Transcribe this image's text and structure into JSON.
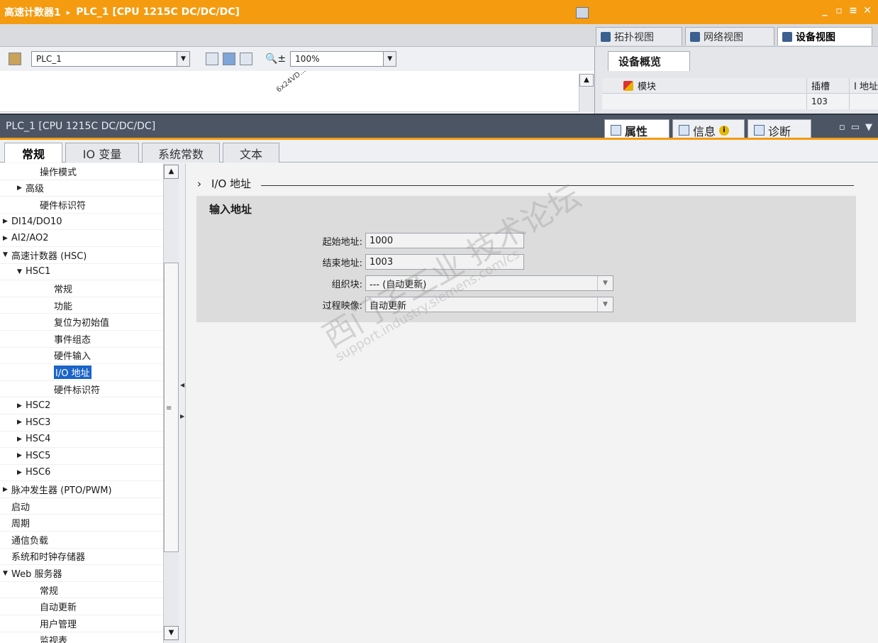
{
  "title_bar": {
    "project": "高速计数器1",
    "separator": "▸",
    "device": "PLC_1 [CPU 1215C DC/DC/DC]"
  },
  "view_tabs": [
    {
      "label": "拓扑视图",
      "active": false
    },
    {
      "label": "网络视图",
      "active": false
    },
    {
      "label": "设备视图",
      "active": true
    }
  ],
  "toolbar": {
    "device_select": "PLC_1",
    "zoom": "100%"
  },
  "device_view": {
    "module_label": "6x24VD..."
  },
  "overview": {
    "tab_label": "设备概览",
    "columns": [
      "模块",
      "插槽",
      "I 地址"
    ],
    "row": {
      "module": "",
      "slot": "103",
      "address": ""
    }
  },
  "properties": {
    "title": "PLC_1 [CPU 1215C DC/DC/DC]",
    "tabs": [
      {
        "label": "属性",
        "active": true
      },
      {
        "label": "信息",
        "active": false
      },
      {
        "label": "诊断",
        "active": false
      }
    ],
    "info_badge": "i"
  },
  "sub_tabs": [
    {
      "label": "常规",
      "active": true
    },
    {
      "label": "IO 变量",
      "active": false
    },
    {
      "label": "系统常数",
      "active": false
    },
    {
      "label": "文本",
      "active": false
    }
  ],
  "tree": [
    {
      "label": "操作模式",
      "indent": 2,
      "toggle": ""
    },
    {
      "label": "高级",
      "indent": 1,
      "toggle": "▶"
    },
    {
      "label": "硬件标识符",
      "indent": 2,
      "toggle": ""
    },
    {
      "label": "DI14/DO10",
      "indent": 0,
      "toggle": "▶"
    },
    {
      "label": "AI2/AO2",
      "indent": 0,
      "toggle": "▶"
    },
    {
      "label": "高速计数器 (HSC)",
      "indent": 0,
      "toggle": "▼"
    },
    {
      "label": "HSC1",
      "indent": 1,
      "toggle": "▼"
    },
    {
      "label": "常规",
      "indent": 3,
      "toggle": ""
    },
    {
      "label": "功能",
      "indent": 3,
      "toggle": ""
    },
    {
      "label": "复位为初始值",
      "indent": 3,
      "toggle": ""
    },
    {
      "label": "事件组态",
      "indent": 3,
      "toggle": ""
    },
    {
      "label": "硬件输入",
      "indent": 3,
      "toggle": ""
    },
    {
      "label": "I/O 地址",
      "indent": 3,
      "toggle": "",
      "selected": true
    },
    {
      "label": "硬件标识符",
      "indent": 3,
      "toggle": ""
    },
    {
      "label": "HSC2",
      "indent": 1,
      "toggle": "▶"
    },
    {
      "label": "HSC3",
      "indent": 1,
      "toggle": "▶"
    },
    {
      "label": "HSC4",
      "indent": 1,
      "toggle": "▶"
    },
    {
      "label": "HSC5",
      "indent": 1,
      "toggle": "▶"
    },
    {
      "label": "HSC6",
      "indent": 1,
      "toggle": "▶"
    },
    {
      "label": "脉冲发生器 (PTO/PWM)",
      "indent": 0,
      "toggle": "▶"
    },
    {
      "label": "启动",
      "indent": 0,
      "toggle": ""
    },
    {
      "label": "周期",
      "indent": 0,
      "toggle": ""
    },
    {
      "label": "通信负载",
      "indent": 0,
      "toggle": ""
    },
    {
      "label": "系统和时钟存储器",
      "indent": 0,
      "toggle": ""
    },
    {
      "label": "Web 服务器",
      "indent": 0,
      "toggle": "▼"
    },
    {
      "label": "常规",
      "indent": 2,
      "toggle": ""
    },
    {
      "label": "自动更新",
      "indent": 2,
      "toggle": ""
    },
    {
      "label": "用户管理",
      "indent": 2,
      "toggle": ""
    },
    {
      "label": "监视表",
      "indent": 2,
      "toggle": ""
    }
  ],
  "content": {
    "section_chevron": "›",
    "section_title": "I/O 地址",
    "group_title": "输入地址",
    "fields": {
      "start_label": "起始地址:",
      "start_value": "1000",
      "end_label": "结束地址:",
      "end_value": "1003",
      "ob_label": "组织块:",
      "ob_value": "--- (自动更新)",
      "pi_label": "过程映像:",
      "pi_value": "自动更新"
    }
  },
  "watermark": {
    "line1": "西门子工业 技术论坛",
    "line2": "support.industry.siemens.com/cs"
  },
  "colors": {
    "accent_orange": "#f49b10",
    "panel_header": "#4b5564",
    "selection_blue": "#1b64c8"
  }
}
